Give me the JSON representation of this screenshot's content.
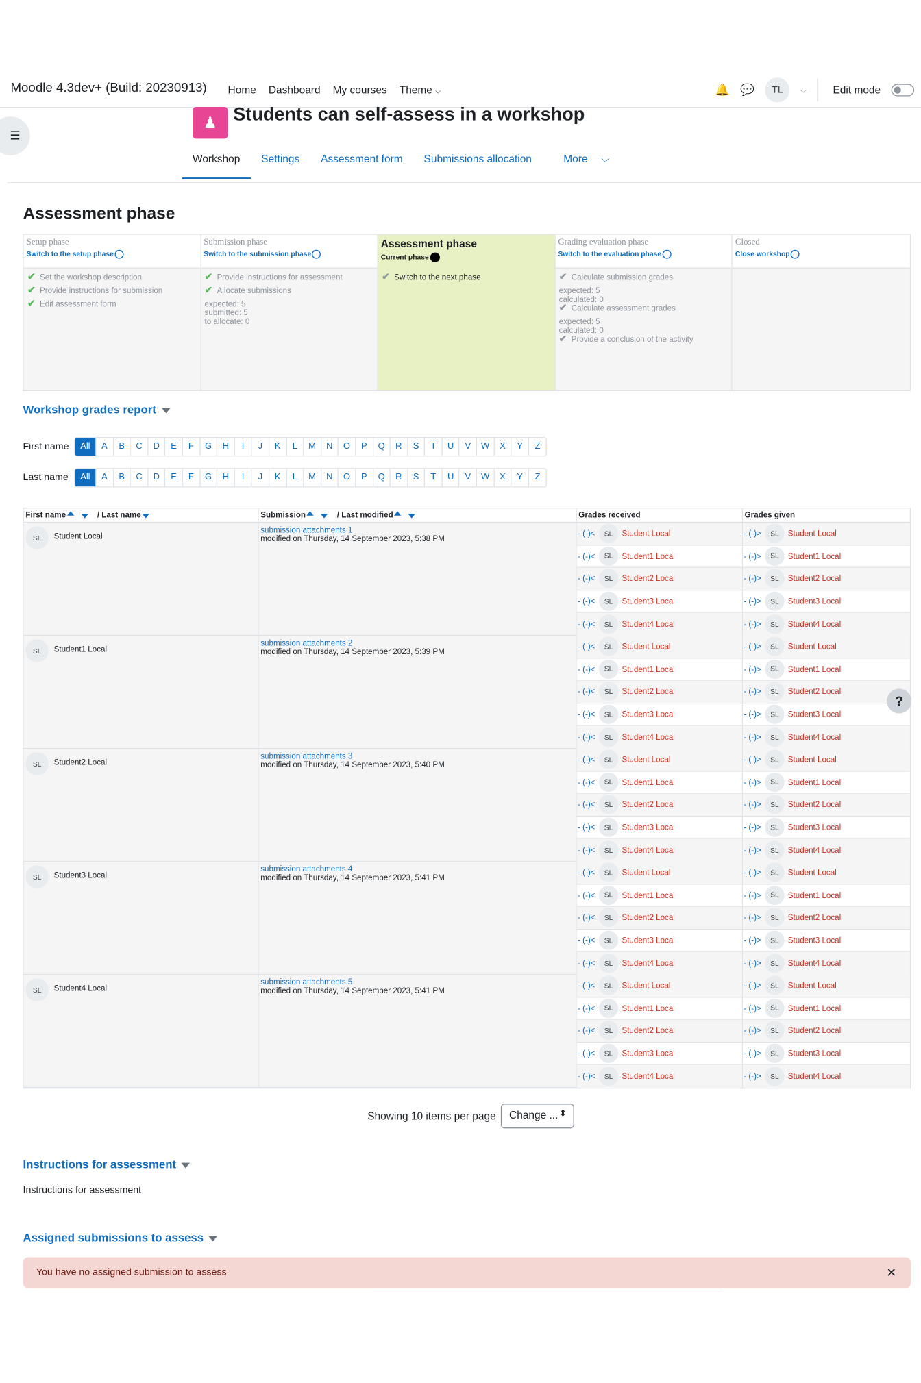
{
  "navbar": {
    "brand": "Moodle 4.3dev+ (Build: 20230913)",
    "links": [
      "Home",
      "Dashboard",
      "My courses",
      "Theme"
    ],
    "user_initials": "TL",
    "edit_mode_label": "Edit mode"
  },
  "header": {
    "title": "Students can self-assess in a workshop",
    "tabs": [
      "Workshop",
      "Settings",
      "Assessment form",
      "Submissions allocation",
      "More"
    ]
  },
  "phase_heading": "Assessment phase",
  "phases": [
    {
      "title": "Setup phase",
      "switch": "Switch to the setup phase",
      "tasks": [
        {
          "label": "Set the workshop description",
          "done": true
        },
        {
          "label": "Provide instructions for submission",
          "done": true
        },
        {
          "label": "Edit assessment form",
          "done": true
        }
      ]
    },
    {
      "title": "Submission phase",
      "switch": "Switch to the submission phase",
      "tasks": [
        {
          "label": "Provide instructions for assessment",
          "done": true
        },
        {
          "label": "Allocate submissions",
          "done": true,
          "details": [
            "expected: 5",
            "submitted: 5",
            "to allocate: 0"
          ]
        }
      ]
    },
    {
      "title": "Assessment phase",
      "switch": "Current phase",
      "current": true,
      "tasks": [
        {
          "label": "Switch to the next phase",
          "done": false
        }
      ]
    },
    {
      "title": "Grading evaluation phase",
      "switch": "Switch to the evaluation phase",
      "tasks": [
        {
          "label": "Calculate submission grades",
          "done": false,
          "details": [
            "expected: 5",
            "calculated: 0"
          ]
        },
        {
          "label": "Calculate assessment grades",
          "done": false,
          "details": [
            "expected: 5",
            "calculated: 0"
          ]
        },
        {
          "label": "Provide a conclusion of the activity",
          "done": false
        }
      ]
    },
    {
      "title": "Closed",
      "switch": "Close workshop",
      "tasks": []
    }
  ],
  "grades_report": {
    "heading": "Workshop grades report",
    "first_name_label": "First name",
    "last_name_label": "Last name",
    "initials": [
      "All",
      "A",
      "B",
      "C",
      "D",
      "E",
      "F",
      "G",
      "H",
      "I",
      "J",
      "K",
      "L",
      "M",
      "N",
      "O",
      "P",
      "Q",
      "R",
      "S",
      "T",
      "U",
      "V",
      "W",
      "X",
      "Y",
      "Z"
    ],
    "columns": {
      "first_name": "First name",
      "last_name": "/ Last name",
      "submission": "Submission",
      "last_modified": "/ Last modified",
      "grades_received": "Grades received",
      "grades_given": "Grades given"
    },
    "received_grade": "- (-)<",
    "given_grade": "- (-)>",
    "initials_badge": "SL",
    "peers": [
      "Student Local",
      "Student1 Local",
      "Student2 Local",
      "Student3 Local",
      "Student4 Local"
    ],
    "rows": [
      {
        "name": "Student Local",
        "submission": "submission attachments 1",
        "modified": "modified on Thursday, 14 September 2023, 5:38 PM"
      },
      {
        "name": "Student1 Local",
        "submission": "submission attachments 2",
        "modified": "modified on Thursday, 14 September 2023, 5:39 PM"
      },
      {
        "name": "Student2 Local",
        "submission": "submission attachments 3",
        "modified": "modified on Thursday, 14 September 2023, 5:40 PM"
      },
      {
        "name": "Student3 Local",
        "submission": "submission attachments 4",
        "modified": "modified on Thursday, 14 September 2023, 5:41 PM"
      },
      {
        "name": "Student4 Local",
        "submission": "submission attachments 5",
        "modified": "modified on Thursday, 14 September 2023, 5:41 PM"
      }
    ],
    "paging_text": "Showing 10 items per page",
    "paging_select": "Change ..."
  },
  "instructions": {
    "heading": "Instructions for assessment",
    "text": "Instructions for assessment"
  },
  "assigned": {
    "heading": "Assigned submissions to assess",
    "alert": "You have no assigned submission to assess"
  },
  "colors": {
    "accent": "#0f6cbf",
    "current_phase": "#e7f1c3",
    "alert_bg": "#f4d6d2",
    "name_red": "#ca3120",
    "module_icon": "#e94595"
  }
}
